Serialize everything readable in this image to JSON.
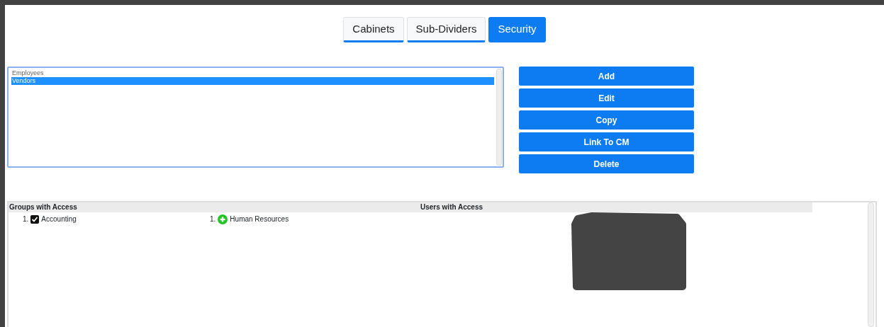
{
  "tabs": [
    {
      "label": "Cabinets",
      "selected": false
    },
    {
      "label": "Sub-Dividers",
      "selected": false
    },
    {
      "label": "Security",
      "selected": true
    }
  ],
  "list": {
    "items": [
      {
        "label": "Employees",
        "selected": false
      },
      {
        "label": "Vendors",
        "selected": true
      }
    ]
  },
  "buttons": [
    "Add",
    "Edit",
    "Copy",
    "Link To CM",
    "Delete"
  ],
  "access": {
    "columns": [
      "Groups with Access",
      "Users with Access"
    ],
    "entries": [
      {
        "number": "1.",
        "label": "Accounting",
        "kind": "checkbox",
        "checked": true
      },
      {
        "number": "1.",
        "label": "Human Resources",
        "kind": "add"
      }
    ]
  }
}
